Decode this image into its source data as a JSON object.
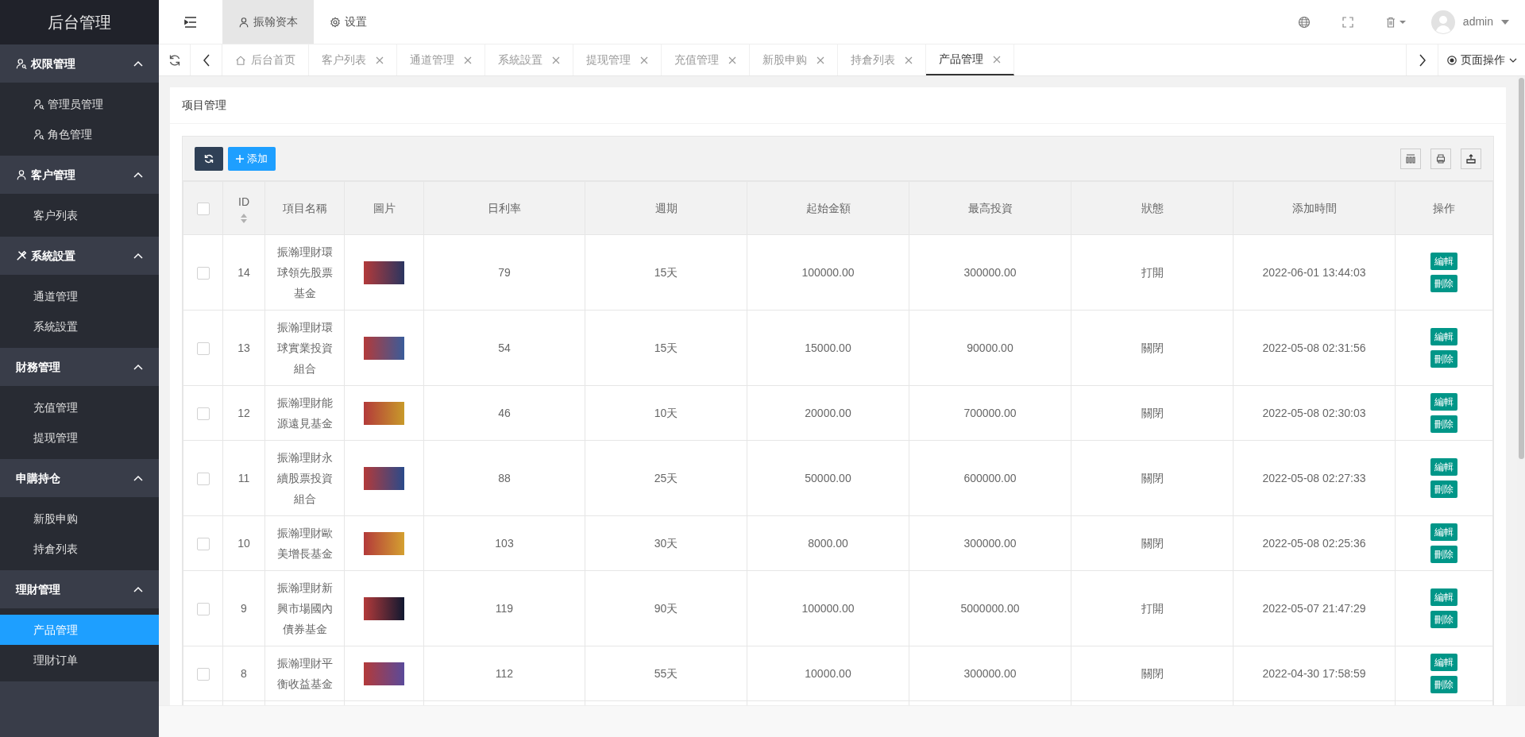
{
  "sidebar": {
    "title": "后台管理",
    "groups": [
      {
        "label": "权限管理",
        "expanded": true,
        "items": [
          {
            "label": "管理员管理",
            "selected": false
          },
          {
            "label": "角色管理",
            "selected": false
          }
        ]
      },
      {
        "label": "客户管理",
        "expanded": true,
        "items": [
          {
            "label": "客户列表",
            "selected": false
          }
        ]
      },
      {
        "label": "系統設置",
        "expanded": true,
        "items": [
          {
            "label": "通道管理",
            "selected": false
          },
          {
            "label": "系統設置",
            "selected": false
          }
        ]
      },
      {
        "label": "財務管理",
        "expanded": true,
        "items": [
          {
            "label": "充值管理",
            "selected": false
          },
          {
            "label": "提现管理",
            "selected": false
          }
        ]
      },
      {
        "label": "申購持仓",
        "expanded": true,
        "items": [
          {
            "label": "新股申购",
            "selected": false
          },
          {
            "label": "持倉列表",
            "selected": false
          }
        ]
      },
      {
        "label": "理財管理",
        "expanded": true,
        "items": [
          {
            "label": "产品管理",
            "selected": true
          },
          {
            "label": "理財订单",
            "selected": false
          }
        ]
      }
    ]
  },
  "header": {
    "nav": [
      {
        "label": "振翰资本",
        "selected": true
      },
      {
        "label": "设置",
        "selected": false
      }
    ],
    "user": "admin"
  },
  "tabs": [
    {
      "label": "后台首页",
      "kind": "home",
      "selected": false
    },
    {
      "label": "客户列表",
      "selected": false
    },
    {
      "label": "通道管理",
      "selected": false
    },
    {
      "label": "系統設置",
      "selected": false
    },
    {
      "label": "提现管理",
      "selected": false
    },
    {
      "label": "充值管理",
      "selected": false
    },
    {
      "label": "新股申购",
      "selected": false
    },
    {
      "label": "持倉列表",
      "selected": false
    },
    {
      "label": "产品管理",
      "selected": true
    }
  ],
  "page_actions": "页面操作",
  "card_title": "项目管理",
  "toolbar": {
    "add": "添加"
  },
  "table": {
    "columns": [
      "ID",
      "項目名稱",
      "圖片",
      "日利率",
      "週期",
      "起始金額",
      "最高投資",
      "狀態",
      "添加時間",
      "操作"
    ],
    "header_checked": false,
    "rows": [
      {
        "checked": false,
        "cells": [
          "14",
          "振瀚理財環球領先股票基金",
          "",
          "79",
          "15天",
          "100000.00",
          "300000.00",
          "打開",
          "2022-06-01 13:44:03"
        ],
        "actions": [
          "編輯",
          "刪除"
        ]
      },
      {
        "checked": false,
        "cells": [
          "13",
          "振瀚理財環球實業投資組合",
          "",
          "54",
          "15天",
          "15000.00",
          "90000.00",
          "關閉",
          "2022-05-08 02:31:56"
        ],
        "actions": [
          "編輯",
          "刪除"
        ]
      },
      {
        "checked": false,
        "cells": [
          "12",
          "振瀚理財能源遠見基金",
          "",
          "46",
          "10天",
          "20000.00",
          "700000.00",
          "關閉",
          "2022-05-08 02:30:03"
        ],
        "actions": [
          "編輯",
          "刪除"
        ]
      },
      {
        "checked": false,
        "cells": [
          "11",
          "振瀚理財永續股票投資組合",
          "",
          "88",
          "25天",
          "50000.00",
          "600000.00",
          "關閉",
          "2022-05-08 02:27:33"
        ],
        "actions": [
          "編輯",
          "刪除"
        ]
      },
      {
        "checked": false,
        "cells": [
          "10",
          "振瀚理財歐美增長基金",
          "",
          "103",
          "30天",
          "8000.00",
          "300000.00",
          "關閉",
          "2022-05-08 02:25:36"
        ],
        "actions": [
          "編輯",
          "刪除"
        ]
      },
      {
        "checked": false,
        "cells": [
          "9",
          "振瀚理財新興市場國內債券基金",
          "",
          "119",
          "90天",
          "100000.00",
          "5000000.00",
          "打開",
          "2022-05-07 21:47:29"
        ],
        "actions": [
          "編輯",
          "刪除"
        ]
      },
      {
        "checked": false,
        "cells": [
          "8",
          "振瀚理財平衡收益基金",
          "",
          "112",
          "55天",
          "10000.00",
          "300000.00",
          "關閉",
          "2022-04-30 17:58:59"
        ],
        "actions": [
          "編輯",
          "刪除"
        ]
      }
    ]
  }
}
